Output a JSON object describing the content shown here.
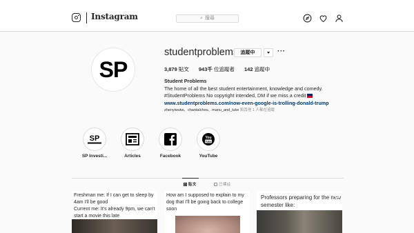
{
  "header": {
    "brand": "Instagram",
    "search_placeholder": "搜尋"
  },
  "profile": {
    "avatar_text": "SP",
    "username": "studentproblems",
    "follow_label": "追蹤中",
    "more_label": "···",
    "stats": [
      {
        "count": "3,879",
        "label": "貼文"
      },
      {
        "count": "943千",
        "label": "位追蹤者"
      },
      {
        "count": "142",
        "label": "追蹤中"
      }
    ],
    "bio": {
      "name": "Student Problems",
      "line1": "The home of all the best student entertainment, knowledge and comedy.",
      "line2": "#StudentProblems No copyright intended, DM if we miss a credit",
      "link": "www.studentproblems.com/now-even-google-is-trolling-donald-trump"
    },
    "followed_by": {
      "users": [
        "zhenyiwutw",
        "chantalchou",
        "manu_and_luke"
      ],
      "rest": "和其他 1 人都在追蹤"
    }
  },
  "highlights": [
    {
      "label": "SP Investi...",
      "icon": "sp-investigates-icon"
    },
    {
      "label": "Articles",
      "icon": "newspaper-icon"
    },
    {
      "label": "Facebook",
      "icon": "facebook-icon"
    },
    {
      "label": "YouTube",
      "icon": "youtube-icon"
    }
  ],
  "tabs": {
    "posts": "貼文",
    "tagged": "已標註"
  },
  "posts": [
    {
      "text": "Freshman me: If I can get to sleep by 4am I'll be good\nCurrent me: It's already 9pm, we can't start a movie this late"
    },
    {
      "text": "How am I supposed to explain to my dog that I'll be going back to college soon"
    },
    {
      "text": "Professors preparing for the new semester like:"
    }
  ],
  "colors": {
    "link": "#00376b",
    "border": "#dbdbdb",
    "background": "#fafafa"
  }
}
